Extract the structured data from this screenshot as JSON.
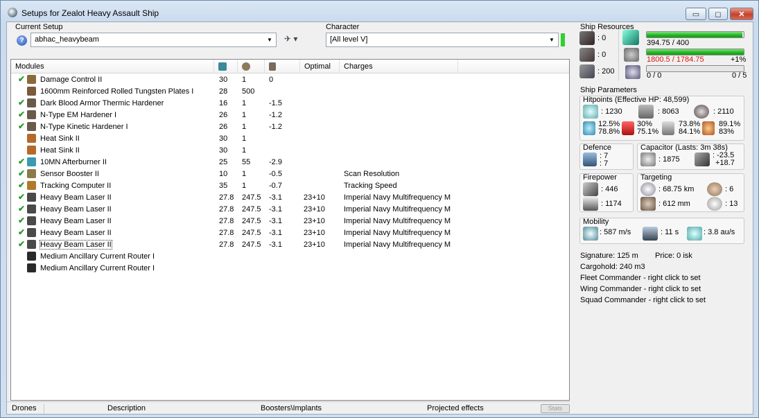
{
  "window": {
    "title": "Setups for Zealot Heavy Assault Ship",
    "min_label": "▭",
    "max_label": "◻",
    "close_label": "✕"
  },
  "setup": {
    "label": "Current Setup",
    "value": "abhac_heavybeam",
    "help_glyph": "?",
    "ship_glyph": "✈ ▾"
  },
  "character": {
    "label": "Character",
    "value": "[All level V]"
  },
  "modules": {
    "columns": [
      "Modules",
      "",
      "",
      "",
      "Optimal",
      "Charges"
    ],
    "rows": [
      {
        "checked": true,
        "name": "Damage Control II",
        "c1": "30",
        "c2": "1",
        "c3": "0",
        "optimal": "",
        "charge": "",
        "icon": "#8a6a3a"
      },
      {
        "checked": false,
        "name": "1600mm Reinforced Rolled Tungsten Plates I",
        "c1": "28",
        "c2": "500",
        "c3": "",
        "optimal": "",
        "charge": "",
        "icon": "#7a5b3a"
      },
      {
        "checked": true,
        "name": "Dark Blood Armor Thermic Hardener",
        "c1": "16",
        "c2": "1",
        "c3": "-1.5",
        "optimal": "",
        "charge": "",
        "icon": "#6a5a4a"
      },
      {
        "checked": true,
        "name": "N-Type EM Hardener I",
        "c1": "26",
        "c2": "1",
        "c3": "-1.2",
        "optimal": "",
        "charge": "",
        "icon": "#6a5a4a"
      },
      {
        "checked": true,
        "name": "N-Type Kinetic Hardener I",
        "c1": "26",
        "c2": "1",
        "c3": "-1.2",
        "optimal": "",
        "charge": "",
        "icon": "#6a5a4a"
      },
      {
        "checked": false,
        "name": "Heat Sink II",
        "c1": "30",
        "c2": "1",
        "c3": "",
        "optimal": "",
        "charge": "",
        "icon": "#b46a2a"
      },
      {
        "checked": false,
        "name": "Heat Sink II",
        "c1": "30",
        "c2": "1",
        "c3": "",
        "optimal": "",
        "charge": "",
        "icon": "#b46a2a"
      },
      {
        "checked": true,
        "name": "10MN Afterburner II",
        "c1": "25",
        "c2": "55",
        "c3": "-2.9",
        "optimal": "",
        "charge": "",
        "icon": "#3a9ab0"
      },
      {
        "checked": true,
        "name": "Sensor Booster II",
        "c1": "10",
        "c2": "1",
        "c3": "-0.5",
        "optimal": "",
        "charge": "Scan Resolution",
        "icon": "#8a7a4a"
      },
      {
        "checked": true,
        "name": "Tracking Computer II",
        "c1": "35",
        "c2": "1",
        "c3": "-0.7",
        "optimal": "",
        "charge": "Tracking Speed",
        "icon": "#b07a2a"
      },
      {
        "checked": true,
        "name": "Heavy Beam Laser II",
        "c1": "27.8",
        "c2": "247.5",
        "c3": "-3.1",
        "optimal": "23+10",
        "charge": "Imperial Navy Multifrequency M",
        "icon": "#4a4a4a"
      },
      {
        "checked": true,
        "name": "Heavy Beam Laser II",
        "c1": "27.8",
        "c2": "247.5",
        "c3": "-3.1",
        "optimal": "23+10",
        "charge": "Imperial Navy Multifrequency M",
        "icon": "#4a4a4a"
      },
      {
        "checked": true,
        "name": "Heavy Beam Laser II",
        "c1": "27.8",
        "c2": "247.5",
        "c3": "-3.1",
        "optimal": "23+10",
        "charge": "Imperial Navy Multifrequency M",
        "icon": "#4a4a4a"
      },
      {
        "checked": true,
        "name": "Heavy Beam Laser II",
        "c1": "27.8",
        "c2": "247.5",
        "c3": "-3.1",
        "optimal": "23+10",
        "charge": "Imperial Navy Multifrequency M",
        "icon": "#4a4a4a"
      },
      {
        "checked": true,
        "name": "Heavy Beam Laser II",
        "c1": "27.8",
        "c2": "247.5",
        "c3": "-3.1",
        "optimal": "23+10",
        "charge": "Imperial Navy Multifrequency M",
        "icon": "#4a4a4a",
        "selected": true
      },
      {
        "checked": false,
        "name": "Medium Ancillary Current Router I",
        "c1": "",
        "c2": "",
        "c3": "",
        "optimal": "",
        "charge": "",
        "icon": "#2a2a2a"
      },
      {
        "checked": false,
        "name": "Medium Ancillary Current Router I",
        "c1": "",
        "c2": "",
        "c3": "",
        "optimal": "",
        "charge": "",
        "icon": "#2a2a2a"
      }
    ]
  },
  "bottom_tabs": {
    "drones": "Drones",
    "description": "Description",
    "boosters": "Boosters\\Implants",
    "projected": "Projected effects",
    "stats": "Stats"
  },
  "resources": {
    "title": "Ship Resources",
    "hardpoints": [
      ": 0",
      ": 0",
      ": 200"
    ],
    "cpu": {
      "text": "394.75 / 400",
      "fraction": 0.987
    },
    "power": {
      "text": "1800.5 / 1784.75",
      "extra": "+1%",
      "fraction": 1.0
    },
    "calib": {
      "left": "0 / 0",
      "right": "0 / 5",
      "fraction": 0
    }
  },
  "params": {
    "title": "Ship Parameters",
    "hp_title": "Hitpoints (Effective HP: 48,599)",
    "shield": ": 1230",
    "armor": ": 8063",
    "hull": ": 2110",
    "res": [
      [
        "12.5%",
        "78.8%"
      ],
      [
        "30%",
        "75.1%"
      ],
      [
        "73.8%",
        "84.1%"
      ],
      [
        "89.1%",
        "83%"
      ]
    ],
    "defence": {
      "title": "Defence",
      "a": ": 7",
      "b": ": 7"
    },
    "capacitor": {
      "title": "Capacitor (Lasts: 3m 38s)",
      "amount": ": 1875",
      "a": ": -23.5",
      "b": "+18.7"
    },
    "firepower": {
      "title": "Firepower",
      "dps": ": 446",
      "volley": ": 1174"
    },
    "targeting": {
      "title": "Targeting",
      "range": ": 68.75 km",
      "targets": ": 6",
      "scan": ": 612 mm",
      "sensor": ": 13"
    },
    "mobility": {
      "title": "Mobility",
      "speed": ": 587 m/s",
      "align": ": 11 s",
      "warp": ": 3.8 au/s"
    }
  },
  "misc": {
    "signature": "Signature: 125 m",
    "price": "Price: 0 isk",
    "cargo": "Cargohold: 240 m3",
    "fleet": "Fleet Commander - right click to set",
    "wing": "Wing Commander - right click to set",
    "squad": "Squad Commander - right click to set"
  },
  "colors": {
    "fill_green": "#1fb51f",
    "overload_red": "#d11111",
    "check": "#2a9a2a"
  }
}
